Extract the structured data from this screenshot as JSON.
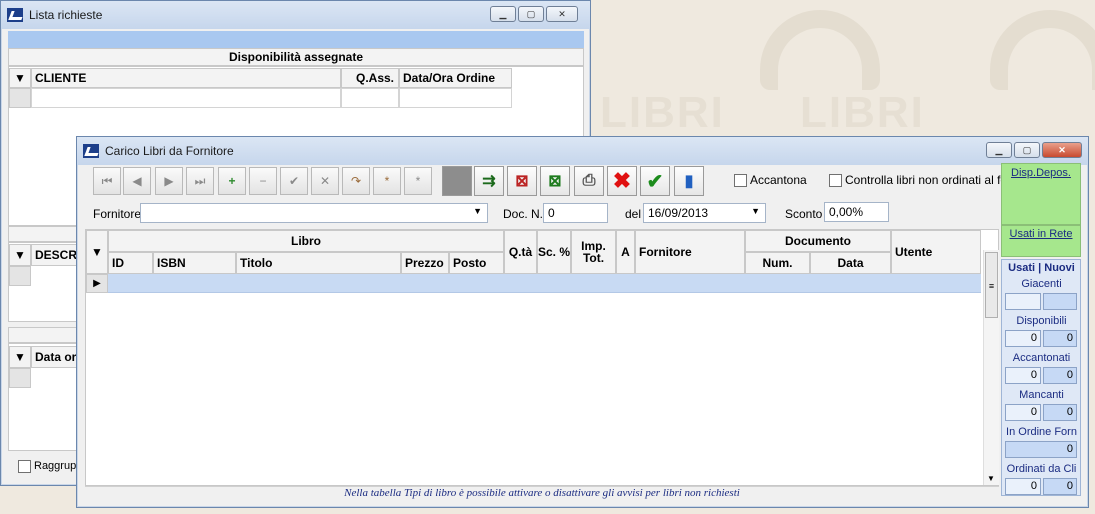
{
  "colors": {
    "accent_green": "#a6e78d",
    "selected_row": "#c8daf3",
    "title_link": "#1b2c82"
  },
  "window_back": {
    "title": "Lista richieste",
    "header": "Disponibilità assegnate",
    "col_cliente": "CLIENTE",
    "col_qass": "Q.Ass.",
    "col_data": "Data/Ora Ordine",
    "col_descr": "DESCR",
    "col_data_or": "Data or",
    "chk_raggrup": "Raggrup"
  },
  "window_main": {
    "title": "Carico Libri da Fornitore",
    "toolbar": {
      "accantona": "Accantona",
      "controlla": "Controlla libri non ordinati al fornitore"
    },
    "filters": {
      "fornitore_label": "Fornitore",
      "fornitore_value": "",
      "doc_label": "Doc. N.",
      "doc_value": "0",
      "del_label": "del",
      "del_value": "16/09/2013",
      "sconto_label": "Sconto",
      "sconto_value": "0,00%"
    },
    "grid": {
      "libro": "Libro",
      "id": "ID",
      "isbn": "ISBN",
      "titolo": "Titolo",
      "prezzo": "Prezzo",
      "posto": "Posto",
      "qta": "Q.tà",
      "sc": "Sc. %",
      "imp": "Imp. Tot.",
      "a": "A",
      "fornitore": "Fornitore",
      "documento": "Documento",
      "num": "Num.",
      "data": "Data",
      "utente": "Utente"
    },
    "status": "Nella tabella Tipi di libro è possibile attivare o disattivare gli avvisi per libri non richiesti",
    "side": {
      "disp_depos": "Disp.Depos.",
      "usati_rete": "Usati in Rete",
      "usati_nuovi": "Usati | Nuovi",
      "giacenti": "Giacenti",
      "giacenti_u": "",
      "giacenti_n": "",
      "disponibili": "Disponibili",
      "disponibili_u": "0",
      "disponibili_n": "0",
      "accantonati": "Accantonati",
      "accantonati_u": "0",
      "accantonati_n": "0",
      "mancanti": "Mancanti",
      "mancanti_u": "0",
      "mancanti_n": "0",
      "in_ordine": "In Ordine Forn",
      "in_ordine_v": "0",
      "ordinati": "Ordinati da Cli",
      "ordinati_u": "0",
      "ordinati_n": "0"
    }
  },
  "watermark": {
    "word": "LIBRI"
  }
}
